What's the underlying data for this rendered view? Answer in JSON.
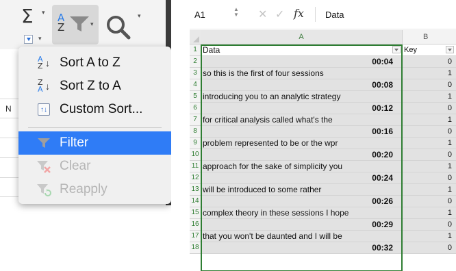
{
  "menu": {
    "items": [
      {
        "label": "Sort A to Z",
        "icon": "sort-a-to-z-icon",
        "enabled": true
      },
      {
        "label": "Sort Z to A",
        "icon": "sort-z-to-a-icon",
        "enabled": true
      },
      {
        "label": "Custom Sort...",
        "icon": "custom-sort-icon",
        "enabled": true
      },
      {
        "label": "Filter",
        "icon": "filter-icon",
        "enabled": true,
        "selected": true
      },
      {
        "label": "Clear",
        "icon": "clear-filter-icon",
        "enabled": false
      },
      {
        "label": "Reapply",
        "icon": "reapply-filter-icon",
        "enabled": false
      }
    ]
  },
  "ribbon": {
    "sort_icon_top": "A",
    "sort_icon_bottom": "Z",
    "column_letter": "N"
  },
  "formula_bar": {
    "cell_ref": "A1",
    "fx": "fx",
    "content": "Data"
  },
  "sheet": {
    "columns": [
      "A",
      "B"
    ],
    "header": {
      "a": "Data",
      "b": "Key"
    },
    "rows": [
      {
        "n": "2",
        "a": "00:04",
        "b": "0",
        "time": true
      },
      {
        "n": "3",
        "a": "so this is the first of four sessions",
        "b": "1",
        "time": false
      },
      {
        "n": "4",
        "a": "00:08",
        "b": "0",
        "time": true
      },
      {
        "n": "5",
        "a": "introducing you to an analytic strategy",
        "b": "1",
        "time": false
      },
      {
        "n": "6",
        "a": "00:12",
        "b": "0",
        "time": true
      },
      {
        "n": "7",
        "a": "for critical analysis called what's the",
        "b": "1",
        "time": false
      },
      {
        "n": "8",
        "a": "00:16",
        "b": "0",
        "time": true
      },
      {
        "n": "9",
        "a": "problem represented to be or the wpr",
        "b": "1",
        "time": false
      },
      {
        "n": "10",
        "a": "00:20",
        "b": "0",
        "time": true
      },
      {
        "n": "11",
        "a": "approach for the sake of simplicity you",
        "b": "1",
        "time": false
      },
      {
        "n": "12",
        "a": "00:24",
        "b": "0",
        "time": true
      },
      {
        "n": "13",
        "a": "will be introduced to some rather",
        "b": "1",
        "time": false
      },
      {
        "n": "14",
        "a": "00:26",
        "b": "0",
        "time": true
      },
      {
        "n": "15",
        "a": "complex theory in these sessions I hope",
        "b": "1",
        "time": false
      },
      {
        "n": "16",
        "a": "00:29",
        "b": "0",
        "time": true
      },
      {
        "n": "17",
        "a": "that you won't be daunted and I will be",
        "b": "1",
        "time": false
      },
      {
        "n": "18",
        "a": "00:32",
        "b": "0",
        "time": true
      }
    ]
  },
  "colors": {
    "menu_selected": "#2f7cf6",
    "accent_green": "#2e7d32",
    "data_fill": "#e2e2e2"
  }
}
